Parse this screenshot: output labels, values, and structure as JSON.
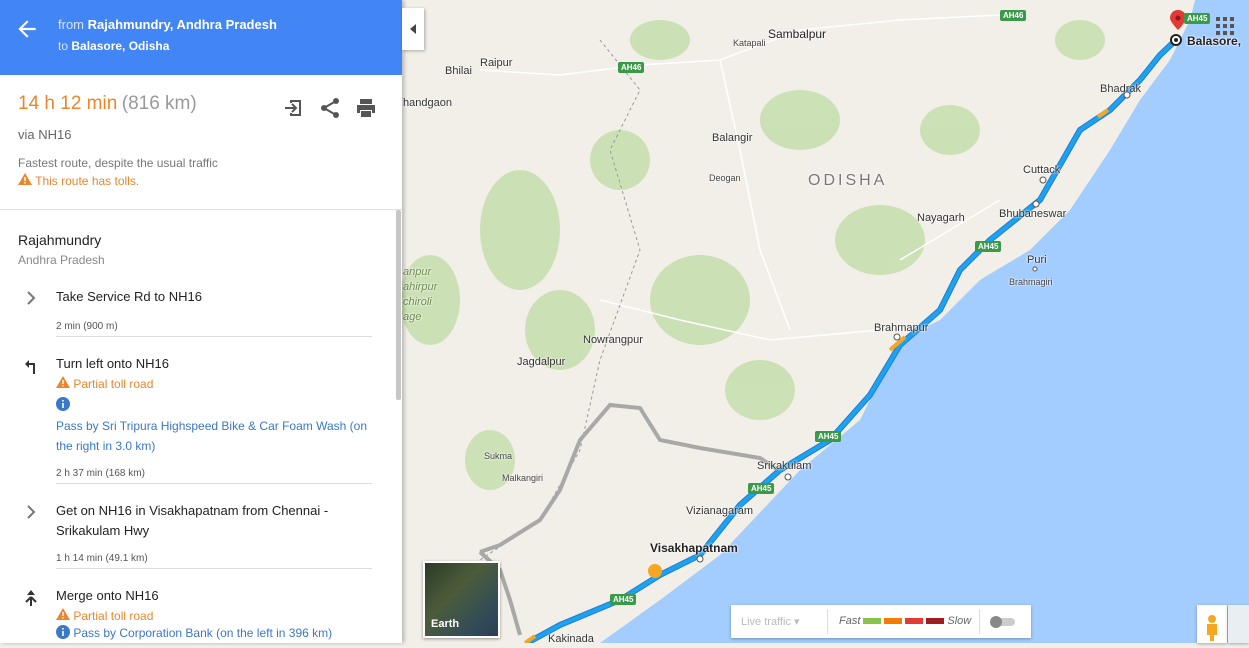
{
  "header": {
    "from_prefix": "from",
    "from_place": "Rajahmundry, Andhra Pradesh",
    "to_prefix": "to",
    "to_place": "Balasore, Odisha"
  },
  "summary": {
    "duration": "14 h 12 min",
    "distance": "(816 km)",
    "via": "via NH16",
    "fastest": "Fastest route, despite the usual traffic",
    "tolls": "This route has tolls."
  },
  "origin": {
    "name": "Rajahmundry",
    "sub": "Andhra Pradesh"
  },
  "steps": [
    {
      "text": "Take Service Rd to NH16",
      "dist": "2 min (900 m)"
    },
    {
      "text": "Turn left onto NH16",
      "warn": "Partial toll road",
      "info": "Pass by Sri Tripura Highspeed Bike & Car Foam Wash (on the right in 3.0 km)",
      "dist": "2 h 37 min (168 km)"
    },
    {
      "text": "Get on NH16 in Visakhapatnam from Chennai - Srikakulam Hwy",
      "dist": "1 h 14 min (49.1 km)"
    },
    {
      "text": "Merge onto NH16",
      "warn": "Partial toll road",
      "info": "Pass by Corporation Bank (on the left in 396 km)"
    }
  ],
  "map": {
    "labels": {
      "sambalpur": "Sambalpur",
      "katapali": "Katapali",
      "bhilai": "Bhilai",
      "raipur": "Raipur",
      "rajnandgaon": "handgaon",
      "balangir": "Balangir",
      "deogan": "Deogan",
      "odisha": "ODISHA",
      "bhadrak": "Bhadrak",
      "balasore": "Balasore,",
      "cuttack": "Cuttack",
      "nayagarh": "Nayagarh",
      "bhubaneswar": "Bhubaneswar",
      "puri": "Puri",
      "brahmagiri": "Brahmagiri",
      "brahmapur": "Brahmapur",
      "nowrangpur": "Nowrangpur",
      "jagdalpur": "Jagdalpur",
      "sukma": "Sukma",
      "malkangiri": "Malkangiri",
      "srikakulam": "Srikakulam",
      "vizianagaram": "Vizianagaram",
      "visakhapatnam": "Visakhapatnam",
      "kakinada": "Kakinada",
      "anpur": "anpur",
      "ahirpur": "ahirpur",
      "chiroli": "chiroli",
      "age": "age"
    },
    "shields": [
      "AH46",
      "AH46",
      "AH45",
      "AH45",
      "AH45",
      "AH45",
      "AH45",
      "AH45"
    ]
  },
  "earth_label": "Earth",
  "traffic": {
    "select": "Live traffic",
    "fast": "Fast",
    "slow": "Slow",
    "colors": [
      "#8bc34a",
      "#f57c00",
      "#e53935",
      "#a11d1d"
    ]
  },
  "colors": {
    "route": "#1ea1f1",
    "header": "#4285f4",
    "accent": "#e8872c",
    "link": "#3b78c6"
  }
}
